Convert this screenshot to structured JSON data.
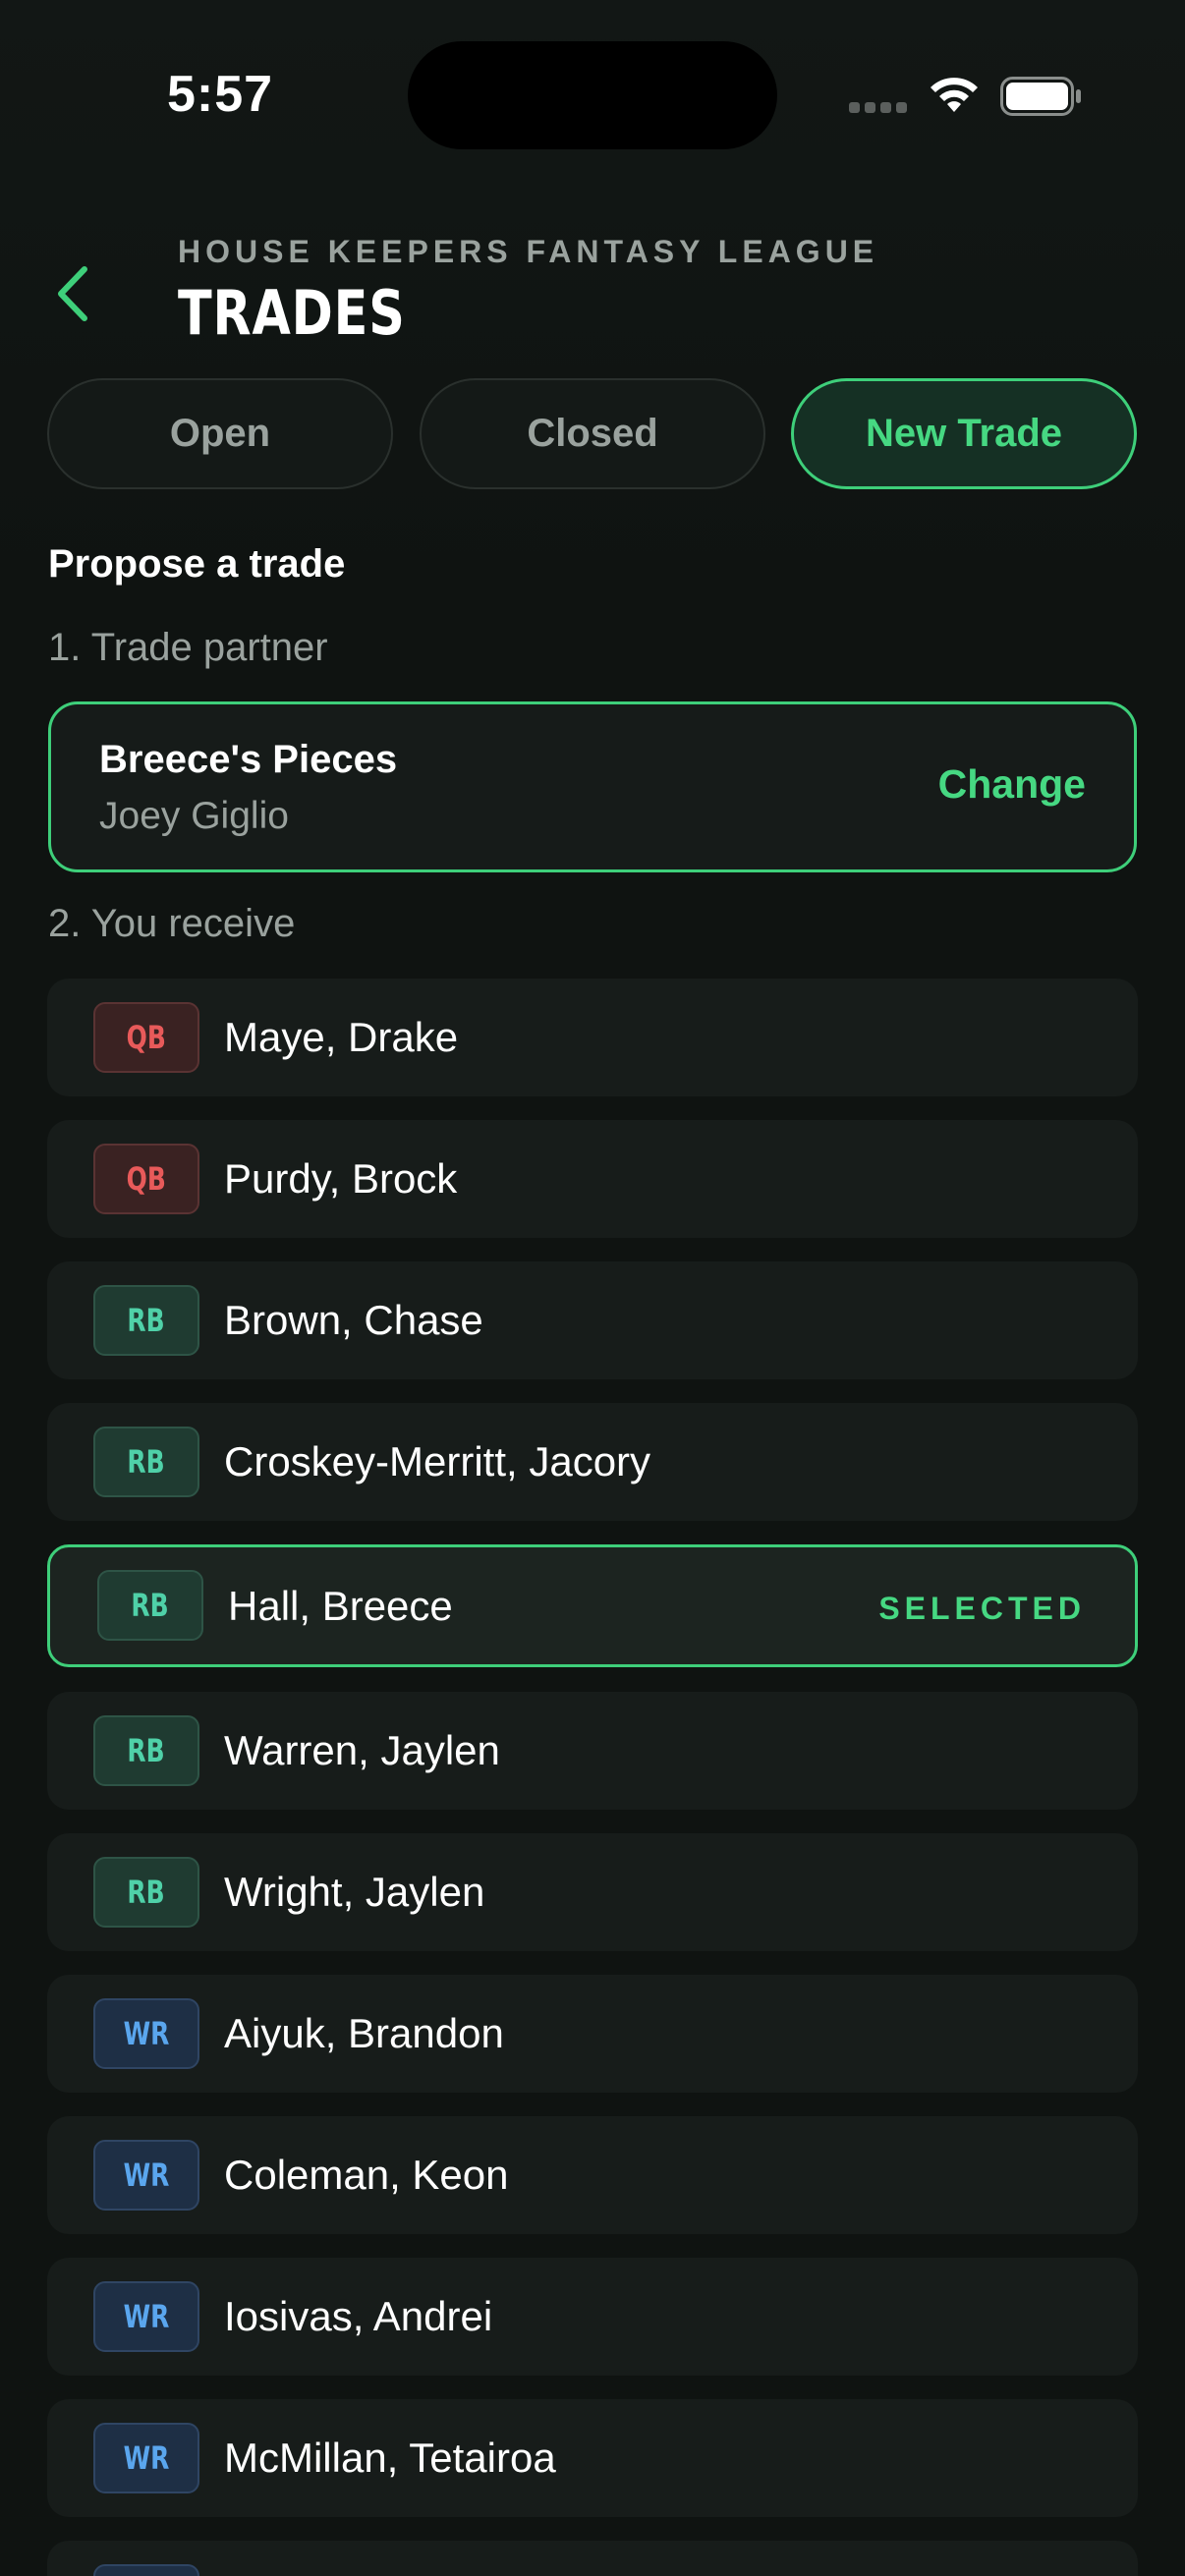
{
  "status_bar": {
    "time": "5:57"
  },
  "header": {
    "league_name": "HOUSE KEEPERS FANTASY LEAGUE",
    "title": "TRADES"
  },
  "tabs": [
    {
      "label": "Open",
      "active": false
    },
    {
      "label": "Closed",
      "active": false
    },
    {
      "label": "New Trade",
      "active": true
    }
  ],
  "propose": {
    "title": "Propose a trade",
    "step1_label": "1. Trade partner",
    "partner": {
      "team": "Breece's Pieces",
      "owner": "Joey Giglio",
      "change_label": "Change"
    },
    "step2_label": "2. You receive"
  },
  "players": [
    {
      "pos": "QB",
      "name": "Maye, Drake",
      "selected": false
    },
    {
      "pos": "QB",
      "name": "Purdy, Brock",
      "selected": false
    },
    {
      "pos": "RB",
      "name": "Brown, Chase",
      "selected": false
    },
    {
      "pos": "RB",
      "name": "Croskey-Merritt, Jacory",
      "selected": false
    },
    {
      "pos": "RB",
      "name": "Hall, Breece",
      "selected": true,
      "tag": "SELECTED"
    },
    {
      "pos": "RB",
      "name": "Warren, Jaylen",
      "selected": false
    },
    {
      "pos": "RB",
      "name": "Wright, Jaylen",
      "selected": false
    },
    {
      "pos": "WR",
      "name": "Aiyuk, Brandon",
      "selected": false
    },
    {
      "pos": "WR",
      "name": "Coleman, Keon",
      "selected": false
    },
    {
      "pos": "WR",
      "name": "Iosivas, Andrei",
      "selected": false
    },
    {
      "pos": "WR",
      "name": "McMillan, Tetairoa",
      "selected": false
    },
    {
      "pos": "WR",
      "name": "",
      "selected": false
    }
  ],
  "colors": {
    "background": "#0f1311",
    "accent": "#3ecf7a",
    "qb": "#e85a5a",
    "rb": "#4fd1a8",
    "wr": "#5aa6ee"
  }
}
